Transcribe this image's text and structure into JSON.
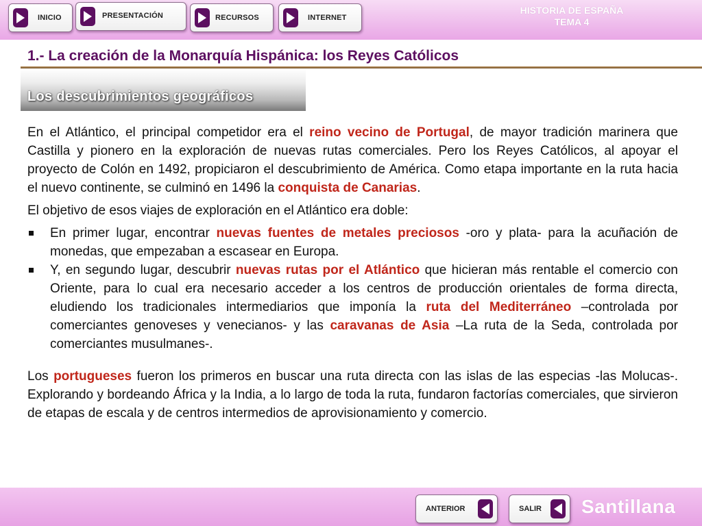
{
  "nav": {
    "inicio": "INICIO",
    "presentacion": "PRESENTACIÓN",
    "recursos": "RECURSOS",
    "internet": "INTERNET"
  },
  "brand": {
    "line1": "HISTORIA DE ESPAÑA",
    "line2": "TEMA 4"
  },
  "heading": "1.- La creación de la Monarquía Hispánica: los Reyes Católicos",
  "section": "Los descubrimientos geográficos",
  "p1": {
    "a": "En el Atlántico, el principal competidor era el ",
    "b": "reino vecino de Portugal",
    "c": ", de mayor tradición marinera que Castilla y pionero en la exploración de nuevas rutas comerciales. Pero los Reyes Católicos, al apoyar el proyecto de Colón en 1492, propiciaron el descubrimiento de América. Como etapa importante en la ruta hacia el nuevo continente, se culminó en 1496 la ",
    "d": "conquista de Canarias",
    "e": "."
  },
  "p2": "El objetivo de esos viajes de exploración en el Atlántico era doble:",
  "bullet1": {
    "a": "En primer lugar, encontrar ",
    "b": "nuevas fuentes de metales preciosos",
    "c": " -oro y plata- para la acuñación de monedas, que empezaban a escasear en Europa."
  },
  "bullet2": {
    "a": "Y, en segundo lugar, descubrir ",
    "b": "nuevas rutas por el Atlántico",
    "c": " que hicieran más rentable el comercio con Oriente, para lo cual era necesario acceder a los centros de producción orientales de forma directa, eludiendo los tradicionales intermediarios que imponía la ",
    "d": "ruta del Mediterráneo",
    "e": " –controlada por comerciantes genoveses y venecianos- y las ",
    "f": "caravanas de Asia",
    "g": " –La ruta de la Seda, controlada por comerciantes musulmanes-."
  },
  "p3": {
    "a": "Los ",
    "b": "portugueses",
    "c": " fueron los primeros en buscar una ruta directa con las islas de las especias -las Molucas-. Explorando y bordeando África y la India, a lo largo de toda la ruta, fundaron factorías comerciales, que sirvieron de etapas de escala y de centros intermedios de aprovisionamiento y comercio."
  },
  "footer": {
    "anterior": "ANTERIOR",
    "salir": "SALIR",
    "logo": "Santillana"
  },
  "colors": {
    "accent": "#5c0f60",
    "highlight": "#c0261a",
    "bar": "#e9a7e6"
  }
}
